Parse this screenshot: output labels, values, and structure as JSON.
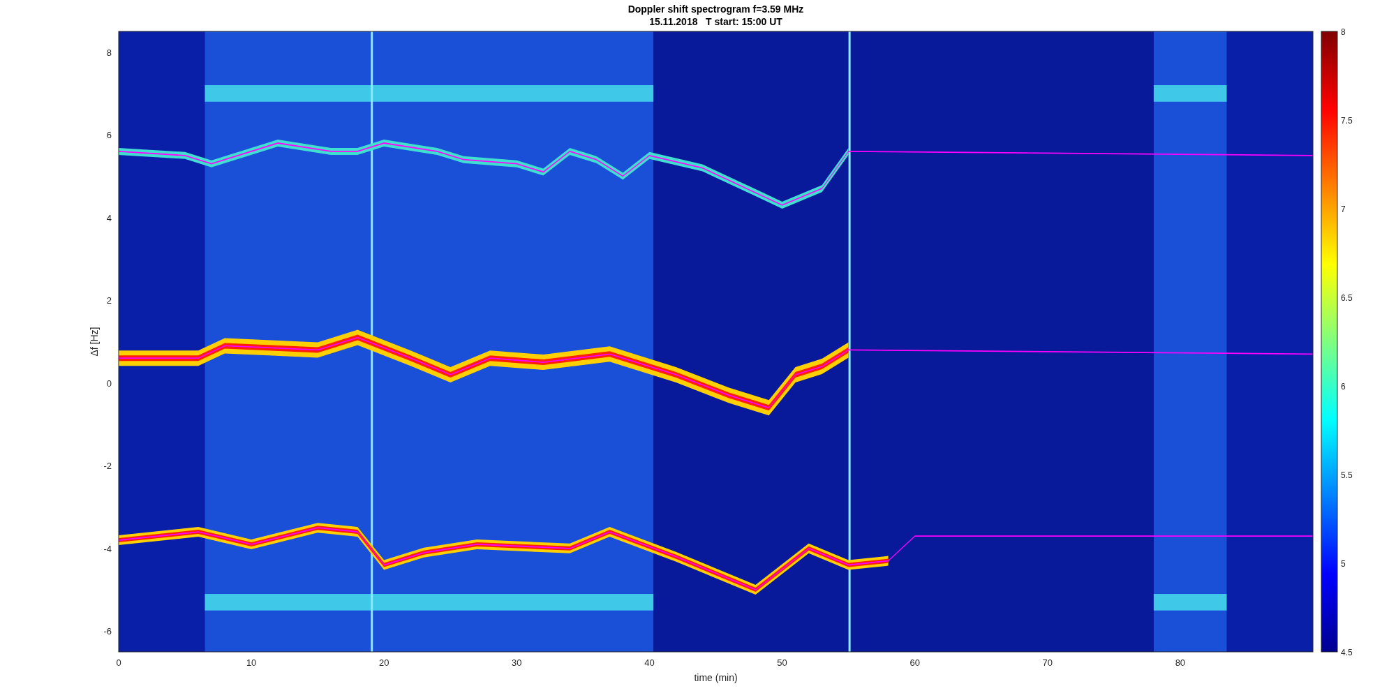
{
  "title": [
    "Doppler shift spectrogram f=3.59 MHz",
    "15.11.2018   T start: 15:00 UT"
  ],
  "x_axis": {
    "label": "time (min)",
    "ticks": [
      "0",
      "10",
      "20",
      "30",
      "40",
      "50",
      "60",
      "70",
      "80"
    ]
  },
  "y_axis": {
    "label": "Δf [Hz]",
    "ticks": [
      "8",
      "6",
      "4",
      "2",
      "0",
      "-2",
      "-4",
      "-6"
    ]
  },
  "colorbar": {
    "ticks": [
      "8",
      "7.5",
      "7",
      "6.5",
      "6",
      "5.5",
      "5",
      "4.5"
    ]
  }
}
